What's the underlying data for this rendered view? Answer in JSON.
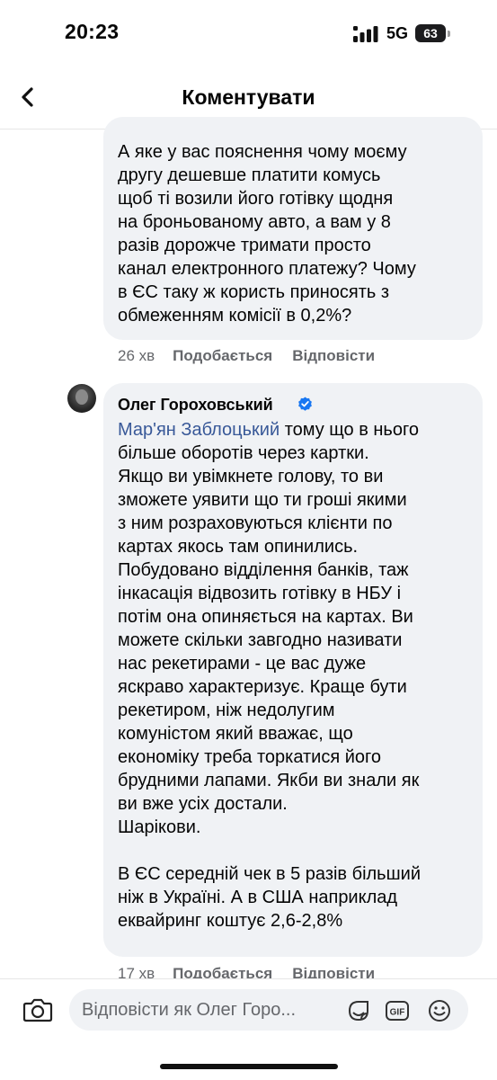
{
  "status_bar": {
    "time": "20:23",
    "network": "5G",
    "battery": "63"
  },
  "header": {
    "title": "Коментувати"
  },
  "comments": [
    {
      "text": "А яке у вас пояснення чому моєму\nдругу дешевше платити комусь\nщоб ті возили його готівку щодня\nна броньованому авто, а вам у 8\nразів дорожче тримати просто\nканал електронного платежу? Чому\nв ЄС таку ж користь приносять з\nобмеженням комісії в 0,2%?",
      "time": "26 хв",
      "like_label": "Подобається",
      "reply_label": "Відповісти"
    },
    {
      "author": "Олег Гороховський",
      "mention": "Мар'ян Заблоцький",
      "text": " тому що в нього\nбільше оборотів через картки.\nЯкщо ви увімкнете голову, то ви\nзможете уявити що ти гроші якими\nз ним розраховуються клієнти по\nкартах якось там опинились.\nПобудовано відділення банків, таж\nінкасація відвозить готівку в НБУ і\nпотім она опиняється на картах. Ви\nможете скільки завгодно називати\nнас рекетирами - це вас дуже\nяскраво характеризує. Краще бути\nрекетиром, ніж недолугим\nкомуністом який вважає, що\nекономіку треба торкатися його\nбрудними лапами. Якби ви знали як\nви вже усіх достали.\nШарікови.\n\nВ ЄС середній чек в 5 разів більший\nніж в Україні. А в США наприклад\nеквайринг коштує 2,6-2,8%",
      "time": "17 хв",
      "like_label": "Подобається",
      "reply_label": "Відповісти"
    }
  ],
  "composer": {
    "placeholder": "Відповісти як Олег Горо..."
  },
  "icons": {
    "back": "chevron-left-icon",
    "verified": "verified-badge-icon",
    "camera": "camera-icon",
    "sticker": "sticker-icon",
    "gif": "gif-icon",
    "emoji": "emoji-icon"
  },
  "colors": {
    "mention": "#385898",
    "verified": "#1877f2",
    "bubble": "#f0f2f5",
    "meta": "#65676b"
  }
}
